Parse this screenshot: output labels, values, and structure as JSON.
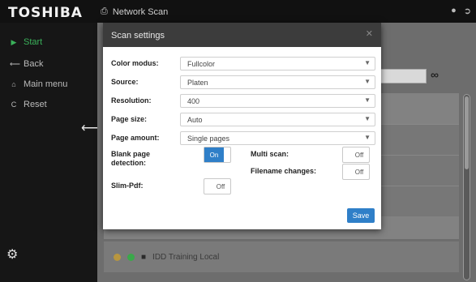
{
  "brand": {
    "logo": "TOSHIBA"
  },
  "topbar": {
    "title": "Network Scan",
    "print_icon": "printer-icon",
    "user_icon": "user-icon",
    "logout_icon": "logout-icon"
  },
  "sidebar": {
    "items": [
      {
        "label": "Start",
        "icon": "play-icon"
      },
      {
        "label": "Back",
        "icon": "arrow-left-icon"
      },
      {
        "label": "Main menu",
        "icon": "home-icon"
      },
      {
        "label": "Reset",
        "icon": "reset-icon"
      }
    ],
    "collapse_icon": "arrow-left-icon",
    "settings_icon": "gear-icon"
  },
  "background": {
    "link_icon": "link-icon",
    "list_row": {
      "label": "IDD Training Local",
      "status_colors": [
        "#c9a34a",
        "#3aa84a"
      ],
      "icon": "folder-icon"
    }
  },
  "dialog": {
    "title": "Scan settings",
    "close_icon": "close-icon",
    "fields": {
      "color_label": "Color modus:",
      "color_value": "Fullcolor",
      "source_label": "Source:",
      "source_value": "Platen",
      "resolution_label": "Resolution:",
      "resolution_value": "400",
      "pagesize_label": "Page size:",
      "pagesize_value": "Auto",
      "pageamount_label": "Page amount:",
      "pageamount_value": "Single pages"
    },
    "toggles": {
      "blank_label": "Blank page detection:",
      "blank_state": "On",
      "multiscan_label": "Multi scan:",
      "multiscan_state": "Off",
      "filename_label": "Filename changes:",
      "filename_state": "Off",
      "slimpdf_label": "Slim-Pdf:",
      "slimpdf_state": "Off"
    },
    "save_label": "Save"
  },
  "colors": {
    "accent": "#2f7fc8",
    "start": "#3ab15a"
  }
}
